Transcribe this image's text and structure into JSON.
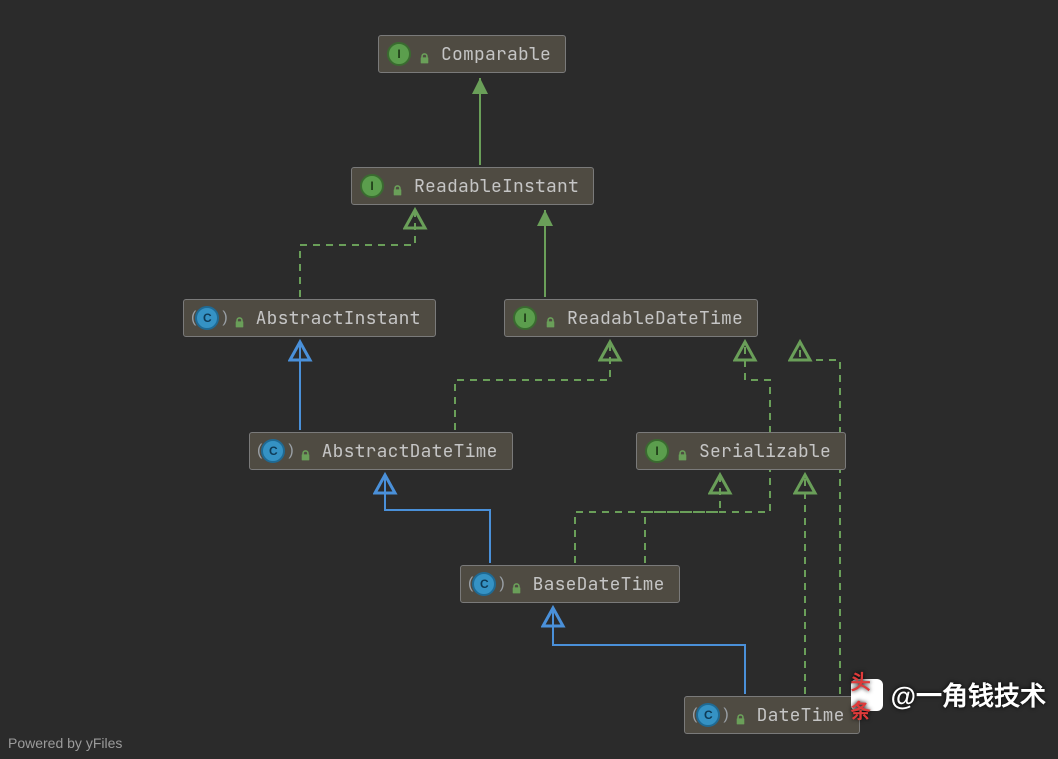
{
  "nodes": {
    "comparable": {
      "kind": "I",
      "label": "Comparable"
    },
    "readableInstant": {
      "kind": "I",
      "label": "ReadableInstant"
    },
    "abstractInstant": {
      "kind": "C",
      "label": "AbstractInstant",
      "paren": true
    },
    "readableDateTime": {
      "kind": "I",
      "label": "ReadableDateTime"
    },
    "abstractDateTime": {
      "kind": "C",
      "label": "AbstractDateTime",
      "paren": true
    },
    "serializable": {
      "kind": "I",
      "label": "Serializable"
    },
    "baseDateTime": {
      "kind": "C",
      "label": "BaseDateTime",
      "paren": true
    },
    "dateTime": {
      "kind": "C",
      "label": "DateTime",
      "paren": true
    }
  },
  "footer": "Powered by yFiles",
  "watermark": "@一角钱技术"
}
